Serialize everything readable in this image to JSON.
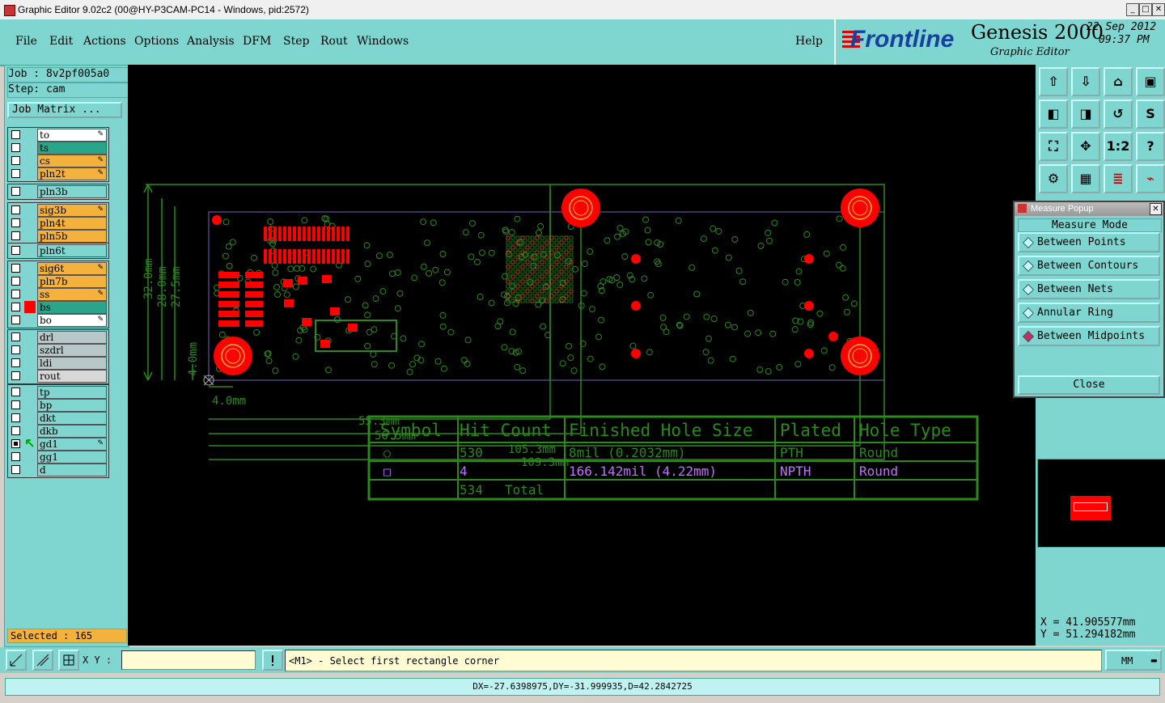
{
  "window": {
    "title": "Graphic Editor 9.02c2 (00@HY-P3CAM-PC14 - Windows, pid:2572)"
  },
  "menu": {
    "items": [
      "File",
      "Edit",
      "Actions",
      "Options",
      "Analysis",
      "DFM",
      "Step",
      "Rout",
      "Windows"
    ],
    "help": "Help"
  },
  "brand": {
    "company": "Frontline",
    "product": "Genesis 2000",
    "subtitle": "Graphic Editor",
    "date": "22 Sep 2012",
    "time": "09:37 PM"
  },
  "job": {
    "job_line": "Job : 8v2pf005a0",
    "step_line": "Step: cam",
    "matrix_button": "Job Matrix ..."
  },
  "layers": [
    {
      "name": "to",
      "color": "#ffffff",
      "edit": true
    },
    {
      "name": "ts",
      "color": "#2aa58a",
      "edit": false
    },
    {
      "name": "cs",
      "color": "#f4b23c",
      "edit": true
    },
    {
      "name": "pln2t",
      "color": "#f4b23c",
      "edit": true
    },
    {
      "name": "pln3b",
      "color": "#7fd6d0",
      "edit": false
    },
    {
      "name": "sig3b",
      "color": "#f4b23c",
      "edit": true
    },
    {
      "name": "pln4t",
      "color": "#f4b23c",
      "edit": false
    },
    {
      "name": "pln5b",
      "color": "#f4b23c",
      "edit": false
    },
    {
      "name": "pln6t",
      "color": "#7fd6d0",
      "edit": false
    },
    {
      "name": "sig6t",
      "color": "#f4b23c",
      "edit": true
    },
    {
      "name": "pln7b",
      "color": "#f4b23c",
      "edit": false
    },
    {
      "name": "ss",
      "color": "#f4b23c",
      "edit": true
    },
    {
      "name": "bs",
      "color": "#2aa58a",
      "edit": false
    },
    {
      "name": "bo",
      "color": "#ffffff",
      "edit": true
    },
    {
      "name": "drl",
      "color": "#b8c8c8",
      "edit": false
    },
    {
      "name": "szdrl",
      "color": "#b8c8c8",
      "edit": false
    },
    {
      "name": "ldi",
      "color": "#b8c8c8",
      "edit": false
    },
    {
      "name": "rout",
      "color": "#d8d8d8",
      "edit": false
    },
    {
      "name": "tp",
      "color": "#7fd6d0",
      "edit": false
    },
    {
      "name": "bp",
      "color": "#7fd6d0",
      "edit": false
    },
    {
      "name": "dkt",
      "color": "#7fd6d0",
      "edit": false
    },
    {
      "name": "dkb",
      "color": "#7fd6d0",
      "edit": false
    },
    {
      "name": "gd1",
      "color": "#7fd6d0",
      "edit": true
    },
    {
      "name": "gg1",
      "color": "#7fd6d0",
      "edit": false
    },
    {
      "name": "d",
      "color": "#7fd6d0",
      "edit": false
    }
  ],
  "selected": "Selected : 165",
  "drawing": {
    "dimensions": [
      "32.0mm",
      "28.0mm",
      "27.5mm",
      "4.0mm",
      "4.0mm",
      "55.3mm",
      "56.5mm",
      "105.3mm",
      "109.3mm"
    ],
    "table": {
      "headers": [
        "Symbol",
        "Hit Count",
        "Finished Hole Size",
        "Plated",
        "Hole Type"
      ],
      "rows": [
        {
          "symbol": "○",
          "count": "530",
          "size": "8mil (0.2032mm)",
          "plated": "PTH",
          "type": "Round"
        },
        {
          "symbol": "□",
          "count": "4",
          "size": "166.142mil (4.22mm)",
          "plated": "NPTH",
          "type": "Round"
        }
      ],
      "total_count": "534",
      "total_label": "Total"
    }
  },
  "measure_popup": {
    "title": "Measure Popup",
    "header": "Measure Mode",
    "modes": [
      "Between Points",
      "Between Contours",
      "Between Nets",
      "Annular Ring",
      "Between Midpoints"
    ],
    "selected_mode": "Between Midpoints",
    "close_label": "Close"
  },
  "toolbar_tools": [
    "zoom-home-icon",
    "pan-icon",
    "home-icon",
    "window-icon",
    "move-left-icon",
    "move-right-icon",
    "undo-icon",
    "snap-icon",
    "fit-icon",
    "center-icon",
    "one-to-two-icon",
    "help-icon",
    "tool-icon",
    "grid-icon",
    "layers-icon",
    "nets-icon"
  ],
  "coords": {
    "x": "X = 41.905577mm",
    "y": "Y = 51.294182mm"
  },
  "bottom": {
    "xy_label": "X Y :",
    "xy_value": "",
    "prompt": "<M1> - Select first rectangle corner",
    "units": "MM"
  },
  "status": "DX=-27.6398975,DY=-31.999935,D=42.2842725",
  "colors": {
    "panel": "#7fd6d0",
    "accent": "#f4b23c",
    "canvas": "#000000",
    "drawing": "#2a8a1a",
    "pad": "#ff0000"
  }
}
